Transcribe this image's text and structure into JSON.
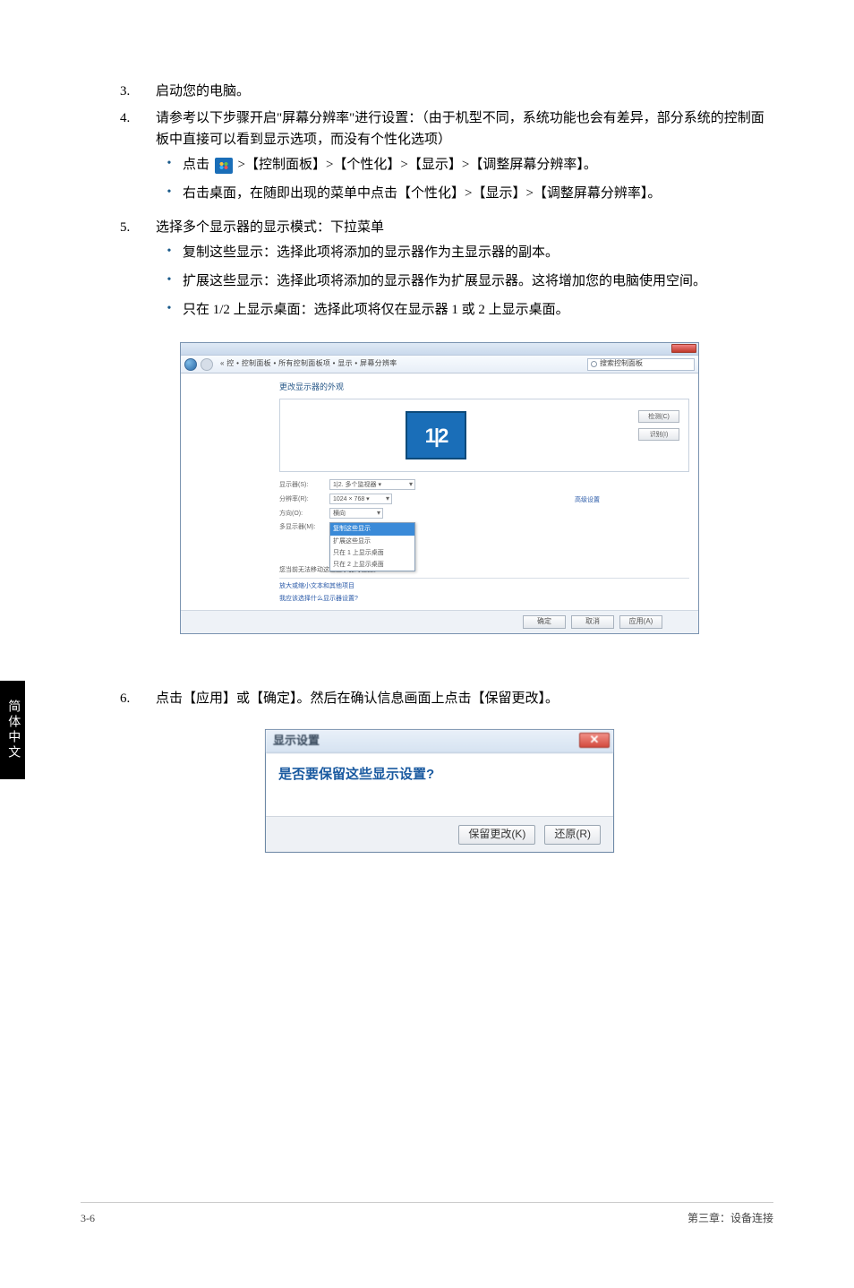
{
  "side_tab": "简体中文",
  "steps": {
    "s3": {
      "num": "3.",
      "text": "启动您的电脑。"
    },
    "s4": {
      "num": "4.",
      "text": "请参考以下步骤开启\"屏幕分辨率\"进行设置：（由于机型不同，系统功能也会有差异，部分系统的控制面板中直接可以看到显示选项，而没有个性化选项）",
      "b1a": "点击 ",
      "b1b": " >【控制面板】>【个性化】>【显示】>【调整屏幕分辨率】。",
      "b2": "右击桌面，在随即出现的菜单中点击【个性化】>【显示】>【调整屏幕分辨率】。"
    },
    "s5": {
      "num": "5.",
      "text": "选择多个显示器的显示模式：下拉菜单",
      "b1": "复制这些显示：选择此项将添加的显示器作为主显示器的副本。",
      "b2": "扩展这些显示：选择此项将添加的显示器作为扩展显示器。这将增加您的电脑使用空间。",
      "b3": "只在 1/2 上显示桌面：选择此项将仅在显示器 1 或 2 上显示桌面。"
    },
    "s6": {
      "num": "6.",
      "text": "点击【应用】或【确定】。然后在确认信息画面上点击【保留更改】。"
    }
  },
  "shot1": {
    "crumb": "« 控 • 控制面板 • 所有控制面板项 • 显示 • 屏幕分辨率",
    "search_placeholder": "搜索控制面板",
    "heading": "更改显示器的外观",
    "monitor_label": "1|2",
    "btn_detect": "检测(C)",
    "btn_identify": "识别(I)",
    "row_display_label": "显示器(S):",
    "row_display_value": "1|2. 多个监视器 ▾",
    "row_res_label": "分辨率(R):",
    "row_res_value": "1024 × 768  ▾",
    "row_orient_label": "方向(O):",
    "row_orient_value": "横向",
    "row_multi_label": "多显示器(M):",
    "menu_opt1": "复制这些显示",
    "menu_opt2": "扩展这些显示",
    "menu_opt3": "只在 1 上显示桌面",
    "menu_opt4": "只在 2 上显示桌面",
    "detect_text": "高级设置",
    "note": "您当前无法移动这些显示器的位置。",
    "link1": "放大或缩小文本和其他项目",
    "link2": "我应该选择什么显示器设置?",
    "footer_ok": "确定",
    "footer_cancel": "取消",
    "footer_apply": "应用(A)"
  },
  "shot2": {
    "title": "显示设置",
    "question": "是否要保留这些显示设置?",
    "keep": "保留更改(K)",
    "revert": "还原(R)"
  },
  "footer": {
    "left": "3-6",
    "right": "第三章：设备连接"
  }
}
